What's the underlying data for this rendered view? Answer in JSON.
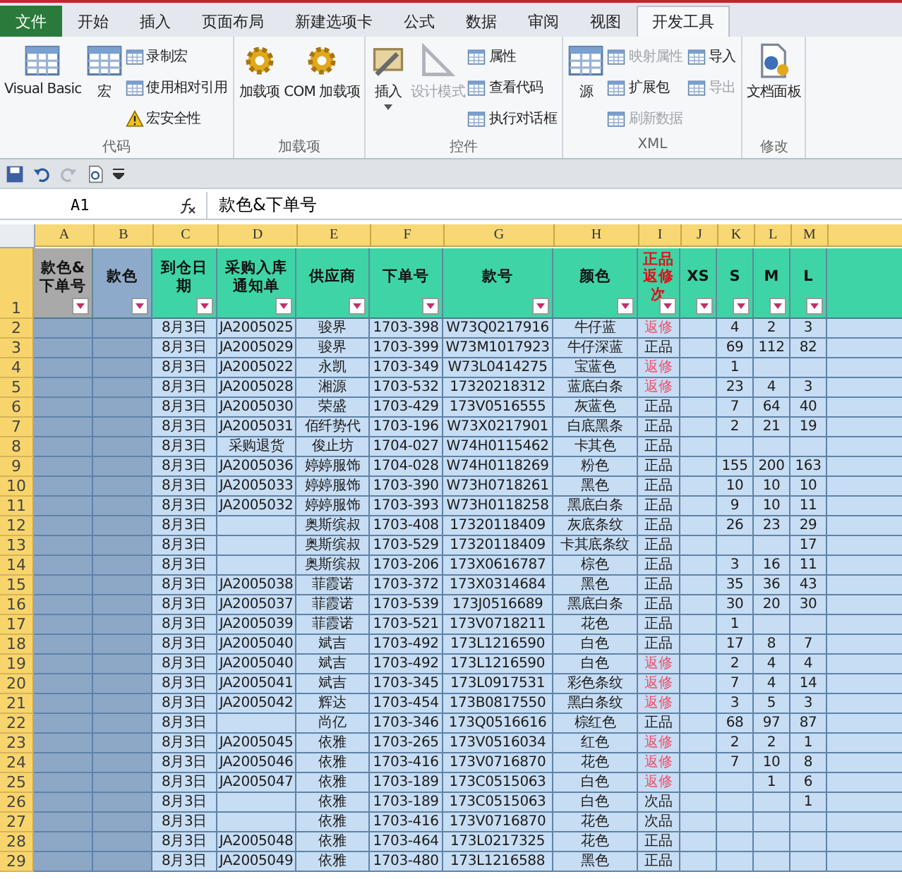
{
  "ribbon_tabs": [
    {
      "label": "文件",
      "kind": "file",
      "selected": false
    },
    {
      "label": "开始",
      "kind": "tab",
      "selected": false
    },
    {
      "label": "插入",
      "kind": "tab",
      "selected": false
    },
    {
      "label": "页面布局",
      "kind": "tab",
      "selected": false
    },
    {
      "label": "新建选项卡",
      "kind": "tab",
      "selected": false
    },
    {
      "label": "公式",
      "kind": "tab",
      "selected": false
    },
    {
      "label": "数据",
      "kind": "tab",
      "selected": false
    },
    {
      "label": "审阅",
      "kind": "tab",
      "selected": false
    },
    {
      "label": "视图",
      "kind": "tab",
      "selected": false
    },
    {
      "label": "开发工具",
      "kind": "tab",
      "selected": true
    }
  ],
  "ribbon_groups": [
    {
      "label": "代码",
      "items": [
        {
          "kind": "large",
          "label": "Visual Basic",
          "disabled": false
        },
        {
          "kind": "large",
          "label": "宏",
          "disabled": false
        },
        {
          "kind": "small",
          "label": "录制宏",
          "disabled": false
        },
        {
          "kind": "small",
          "label": "使用相对引用",
          "disabled": false
        },
        {
          "kind": "small",
          "label": "宏安全性",
          "disabled": false
        }
      ]
    },
    {
      "label": "加载项",
      "items": [
        {
          "kind": "large",
          "label": "加载项",
          "disabled": false
        },
        {
          "kind": "large",
          "label": "COM 加载项",
          "disabled": false
        }
      ]
    },
    {
      "label": "控件",
      "items": [
        {
          "kind": "large",
          "label": "插入",
          "disabled": false,
          "dropdown": true
        },
        {
          "kind": "large",
          "label": "设计模式",
          "disabled": true
        },
        {
          "kind": "small",
          "label": "属性",
          "disabled": false
        },
        {
          "kind": "small",
          "label": "查看代码",
          "disabled": false
        },
        {
          "kind": "small",
          "label": "执行对话框",
          "disabled": false
        }
      ]
    },
    {
      "label": "XML",
      "items": [
        {
          "kind": "large",
          "label": "源",
          "disabled": false
        },
        {
          "kind": "small",
          "label": "映射属性",
          "disabled": true
        },
        {
          "kind": "small",
          "label": "扩展包",
          "disabled": false
        },
        {
          "kind": "small",
          "label": "刷新数据",
          "disabled": true
        },
        {
          "kind": "small",
          "label": "导入",
          "disabled": false
        },
        {
          "kind": "small",
          "label": "导出",
          "disabled": true
        }
      ]
    },
    {
      "label": "修改",
      "items": [
        {
          "kind": "large",
          "label": "文档面板",
          "disabled": false
        }
      ]
    }
  ],
  "name_box": "A1",
  "formula": "款色&下单号",
  "columns": [
    "A",
    "B",
    "C",
    "D",
    "E",
    "F",
    "G",
    "H",
    "I",
    "J",
    "K",
    "L",
    "M"
  ],
  "header_row": {
    "number": "1",
    "cells": [
      {
        "label": "款色&下单号",
        "kind": "gray",
        "alert": false
      },
      {
        "label": "款色",
        "kind": "blue",
        "alert": false
      },
      {
        "label": "到仓日期",
        "kind": "teal",
        "alert": false
      },
      {
        "label": "采购入库通知单",
        "kind": "teal",
        "alert": false
      },
      {
        "label": "供应商",
        "kind": "teal",
        "alert": false
      },
      {
        "label": "下单号",
        "kind": "teal",
        "alert": false
      },
      {
        "label": "款号",
        "kind": "teal",
        "alert": false
      },
      {
        "label": "颜色",
        "kind": "teal",
        "alert": false
      },
      {
        "label": "正品返修次",
        "kind": "teal",
        "alert": true
      },
      {
        "label": "XS",
        "kind": "teal",
        "alert": false
      },
      {
        "label": "S",
        "kind": "teal",
        "alert": false
      },
      {
        "label": "M",
        "kind": "teal",
        "alert": false
      },
      {
        "label": "L",
        "kind": "teal",
        "alert": false
      }
    ]
  },
  "rows": [
    {
      "n": "2",
      "date": "8月3日",
      "order": "JA2005025",
      "supplier": "骏界",
      "po": "1703-398",
      "style": "W73Q0217916",
      "color_name": "牛仔蓝",
      "grade": "返修",
      "alert": true,
      "s": "4",
      "m": "2",
      "l": "3"
    },
    {
      "n": "3",
      "date": "8月3日",
      "order": "JA2005029",
      "supplier": "骏界",
      "po": "1703-399",
      "style": "W73M1017923",
      "color_name": "牛仔深蓝",
      "grade": "正品",
      "alert": false,
      "s": "69",
      "m": "112",
      "l": "82"
    },
    {
      "n": "4",
      "date": "8月3日",
      "order": "JA2005022",
      "supplier": "永凯",
      "po": "1703-349",
      "style": "W73L0414275",
      "color_name": "宝蓝色",
      "grade": "返修",
      "alert": true,
      "s": "1"
    },
    {
      "n": "5",
      "date": "8月3日",
      "order": "JA2005028",
      "supplier": "湘源",
      "po": "1703-532",
      "style": "17320218312",
      "color_name": "蓝底白条",
      "grade": "返修",
      "alert": true,
      "s": "23",
      "m": "4",
      "l": "3"
    },
    {
      "n": "6",
      "date": "8月3日",
      "order": "JA2005030",
      "supplier": "荣盛",
      "po": "1703-429",
      "style": "173V0516555",
      "color_name": "灰蓝色",
      "grade": "正品",
      "alert": false,
      "s": "7",
      "m": "64",
      "l": "40"
    },
    {
      "n": "7",
      "date": "8月3日",
      "order": "JA2005031",
      "supplier": "佰纤势代",
      "po": "1703-196",
      "style": "W73X0217901",
      "color_name": "白底黑条",
      "grade": "正品",
      "alert": false,
      "s": "2",
      "m": "21",
      "l": "19"
    },
    {
      "n": "8",
      "date": "8月3日",
      "order": "采购退货",
      "supplier": "俊止坊",
      "po": "1704-027",
      "style": "W74H0115462",
      "color_name": "卡其色",
      "grade": "正品",
      "alert": false
    },
    {
      "n": "9",
      "date": "8月3日",
      "order": "JA2005036",
      "supplier": "婷婷服饰",
      "po": "1704-028",
      "style": "W74H0118269",
      "color_name": "粉色",
      "grade": "正品",
      "alert": false,
      "s": "155",
      "m": "200",
      "l": "163"
    },
    {
      "n": "10",
      "date": "8月3日",
      "order": "JA2005033",
      "supplier": "婷婷服饰",
      "po": "1703-390",
      "style": "W73H0718261",
      "color_name": "黑色",
      "grade": "正品",
      "alert": false,
      "s": "10",
      "m": "10",
      "l": "10"
    },
    {
      "n": "11",
      "date": "8月3日",
      "order": "JA2005032",
      "supplier": "婷婷服饰",
      "po": "1703-393",
      "style": "W73H0118258",
      "color_name": "黑底白条",
      "grade": "正品",
      "alert": false,
      "s": "9",
      "m": "10",
      "l": "11"
    },
    {
      "n": "12",
      "date": "8月3日",
      "supplier": "奥斯缤叔",
      "po": "1703-408",
      "style": "17320118409",
      "color_name": "灰底条纹",
      "grade": "正品",
      "alert": false,
      "s": "26",
      "m": "23",
      "l": "29"
    },
    {
      "n": "13",
      "date": "8月3日",
      "supplier": "奥斯缤叔",
      "po": "1703-529",
      "style": "17320118409",
      "color_name": "卡其底条纹",
      "grade": "正品",
      "alert": false,
      "l": "17"
    },
    {
      "n": "14",
      "date": "8月3日",
      "supplier": "奥斯缤叔",
      "po": "1703-206",
      "style": "173X0616787",
      "color_name": "棕色",
      "grade": "正品",
      "alert": false,
      "s": "3",
      "m": "16",
      "l": "11"
    },
    {
      "n": "15",
      "date": "8月3日",
      "order": "JA2005038",
      "supplier": "菲霞诺",
      "po": "1703-372",
      "style": "173X0314684",
      "color_name": "黑色",
      "grade": "正品",
      "alert": false,
      "s": "35",
      "m": "36",
      "l": "43"
    },
    {
      "n": "16",
      "date": "8月3日",
      "order": "JA2005037",
      "supplier": "菲霞诺",
      "po": "1703-539",
      "style": "173J0516689",
      "color_name": "黑底白条",
      "grade": "正品",
      "alert": false,
      "s": "30",
      "m": "20",
      "l": "30"
    },
    {
      "n": "17",
      "date": "8月3日",
      "order": "JA2005039",
      "supplier": "菲霞诺",
      "po": "1703-521",
      "style": "173V0718211",
      "color_name": "花色",
      "grade": "正品",
      "alert": false,
      "s": "1"
    },
    {
      "n": "18",
      "date": "8月3日",
      "order": "JA2005040",
      "supplier": "斌吉",
      "po": "1703-492",
      "style": "173L1216590",
      "color_name": "白色",
      "grade": "正品",
      "alert": false,
      "s": "17",
      "m": "8",
      "l": "7"
    },
    {
      "n": "19",
      "date": "8月3日",
      "order": "JA2005040",
      "supplier": "斌吉",
      "po": "1703-492",
      "style": "173L1216590",
      "color_name": "白色",
      "grade": "返修",
      "alert": true,
      "s": "2",
      "m": "4",
      "l": "4"
    },
    {
      "n": "20",
      "date": "8月3日",
      "order": "JA2005041",
      "supplier": "斌吉",
      "po": "1703-345",
      "style": "173L0917531",
      "color_name": "彩色条纹",
      "grade": "返修",
      "alert": true,
      "s": "7",
      "m": "4",
      "l": "14"
    },
    {
      "n": "21",
      "date": "8月3日",
      "order": "JA2005042",
      "supplier": "辉达",
      "po": "1703-454",
      "style": "173B0817550",
      "color_name": "黑白条纹",
      "grade": "返修",
      "alert": true,
      "s": "3",
      "m": "5",
      "l": "3"
    },
    {
      "n": "22",
      "date": "8月3日",
      "supplier": "尚亿",
      "po": "1703-346",
      "style": "173Q0516616",
      "color_name": "棕红色",
      "grade": "正品",
      "alert": false,
      "s": "68",
      "m": "97",
      "l": "87"
    },
    {
      "n": "23",
      "date": "8月3日",
      "order": "JA2005045",
      "supplier": "依雅",
      "po": "1703-265",
      "style": "173V0516034",
      "color_name": "红色",
      "grade": "返修",
      "alert": true,
      "s": "2",
      "m": "2",
      "l": "1"
    },
    {
      "n": "24",
      "date": "8月3日",
      "order": "JA2005046",
      "supplier": "依雅",
      "po": "1703-416",
      "style": "173V0716870",
      "color_name": "花色",
      "grade": "返修",
      "alert": true,
      "s": "7",
      "m": "10",
      "l": "8"
    },
    {
      "n": "25",
      "date": "8月3日",
      "order": "JA2005047",
      "supplier": "依雅",
      "po": "1703-189",
      "style": "173C0515063",
      "color_name": "白色",
      "grade": "返修",
      "alert": true,
      "m": "1",
      "l": "6"
    },
    {
      "n": "26",
      "date": "8月3日",
      "supplier": "依雅",
      "po": "1703-189",
      "style": "173C0515063",
      "color_name": "白色",
      "grade": "次品",
      "alert": false,
      "l": "1"
    },
    {
      "n": "27",
      "date": "8月3日",
      "supplier": "依雅",
      "po": "1703-416",
      "style": "173V0716870",
      "color_name": "花色",
      "grade": "次品",
      "alert": false
    },
    {
      "n": "28",
      "date": "8月3日",
      "order": "JA2005048",
      "supplier": "依雅",
      "po": "1703-464",
      "style": "173L0217325",
      "color_name": "花色",
      "grade": "正品",
      "alert": false
    },
    {
      "n": "29",
      "date": "8月3日",
      "order": "JA2005049",
      "supplier": "依雅",
      "po": "1703-480",
      "style": "173L1216588",
      "color_name": "黑色",
      "grade": "正品",
      "alert": false
    }
  ]
}
